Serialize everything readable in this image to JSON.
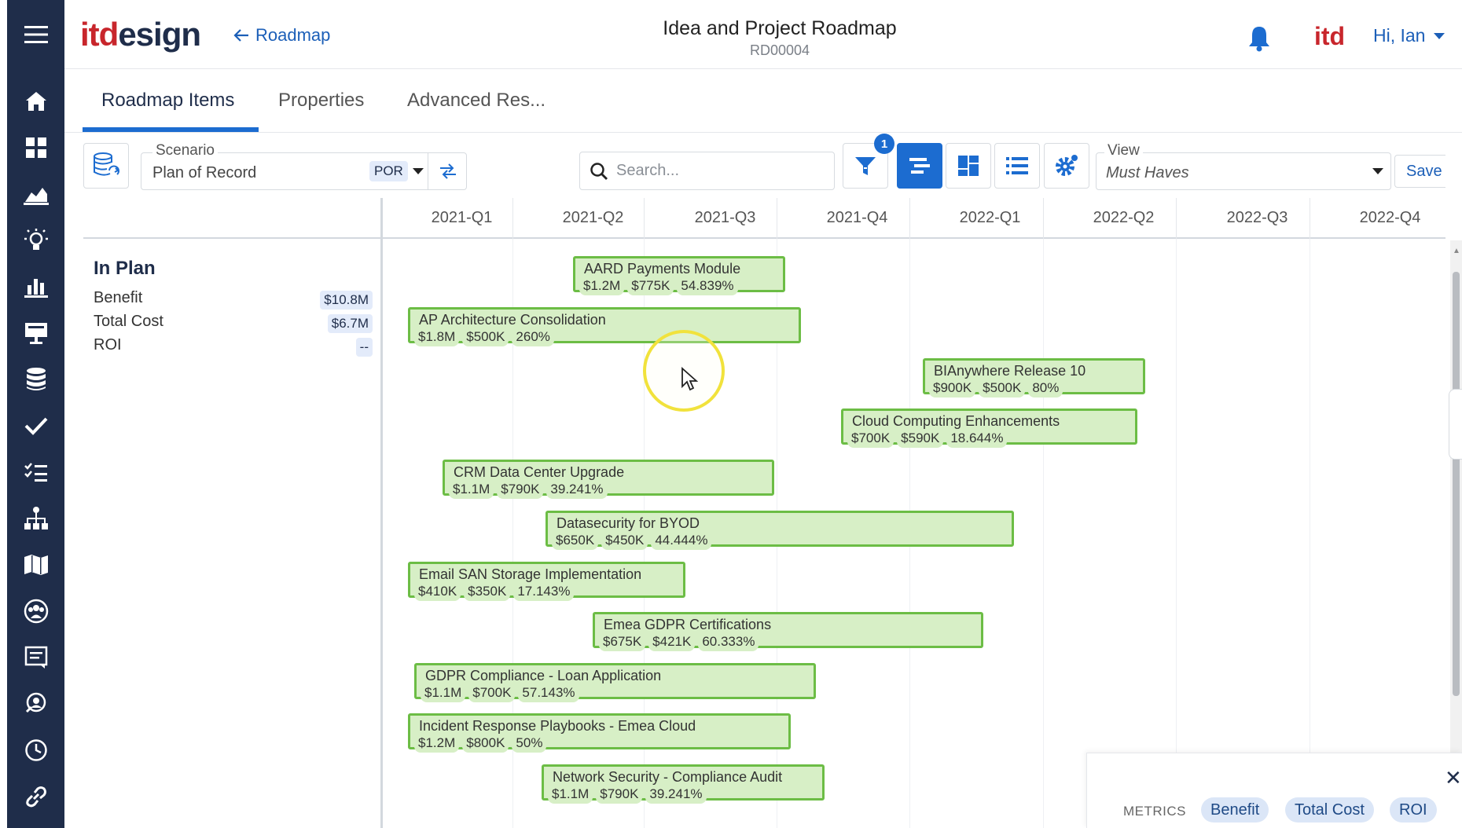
{
  "app": {
    "logo_part1": "itd",
    "logo_part2": "esign",
    "back_label": "Roadmap",
    "title": "Idea and Project Roadmap",
    "record_id": "RD00004",
    "brand_small": "itd",
    "user_greeting": "Hi, Ian"
  },
  "sidenav": {
    "icons": [
      "home-icon",
      "dashboard-icon",
      "area-chart-icon",
      "idea-bulb-icon",
      "bar-chart-icon",
      "presentation-icon",
      "database-icon",
      "check-icon",
      "checklist-icon",
      "org-chart-icon",
      "map-icon",
      "team-icon",
      "report-icon",
      "support-icon",
      "clock-icon",
      "link-icon"
    ]
  },
  "tabs": [
    "Roadmap Items",
    "Properties",
    "Advanced Res..."
  ],
  "toolbar": {
    "scenario_label": "Scenario",
    "scenario_value": "Plan of Record",
    "scenario_chip": "POR",
    "search_placeholder": "Search...",
    "filter_count": "1",
    "view_label": "View",
    "view_value": "Must Haves",
    "save_label": "Save"
  },
  "timeline": {
    "quarters": [
      "2021-Q1",
      "2021-Q2",
      "2021-Q3",
      "2021-Q4",
      "2022-Q1",
      "2022-Q2",
      "2022-Q3",
      "2022-Q4"
    ]
  },
  "summary": {
    "heading": "In Plan",
    "rows": [
      {
        "label": "Benefit",
        "value": "$10.8M"
      },
      {
        "label": "Total Cost",
        "value": "$6.7M"
      },
      {
        "label": "ROI",
        "value": "--"
      }
    ]
  },
  "items": [
    {
      "name": "AARD Payments Module",
      "benefit": "$1.2M",
      "cost": "$775K",
      "roi": "54.839%"
    },
    {
      "name": "AP Architecture Consolidation",
      "benefit": "$1.8M",
      "cost": "$500K",
      "roi": "260%"
    },
    {
      "name": "BIAnywhere Release 10",
      "benefit": "$900K",
      "cost": "$500K",
      "roi": "80%"
    },
    {
      "name": "Cloud Computing Enhancements",
      "benefit": "$700K",
      "cost": "$590K",
      "roi": "18.644%"
    },
    {
      "name": "CRM Data Center Upgrade",
      "benefit": "$1.1M",
      "cost": "$790K",
      "roi": "39.241%"
    },
    {
      "name": "Datasecurity for BYOD",
      "benefit": "$650K",
      "cost": "$450K",
      "roi": "44.444%"
    },
    {
      "name": "Email SAN Storage Implementation",
      "benefit": "$410K",
      "cost": "$350K",
      "roi": "17.143%"
    },
    {
      "name": "Emea GDPR Certifications",
      "benefit": "$675K",
      "cost": "$421K",
      "roi": "60.333%"
    },
    {
      "name": "GDPR Compliance - Loan Application",
      "benefit": "$1.1M",
      "cost": "$700K",
      "roi": "57.143%"
    },
    {
      "name": "Incident Response Playbooks - Emea Cloud",
      "benefit": "$1.2M",
      "cost": "$800K",
      "roi": "50%"
    },
    {
      "name": "Network Security - Compliance Audit",
      "benefit": "$1.1M",
      "cost": "$790K",
      "roi": "39.241%"
    }
  ],
  "metrics_panel": {
    "label": "METRICS",
    "chips": [
      "Benefit",
      "Total Cost",
      "ROI"
    ]
  },
  "colors": {
    "nav_bg": "#1f2d4a",
    "accent": "#1c6cd0",
    "bar_fill": "#d7efc6",
    "bar_border": "#6cbd45",
    "brand_red": "#c8262c"
  }
}
